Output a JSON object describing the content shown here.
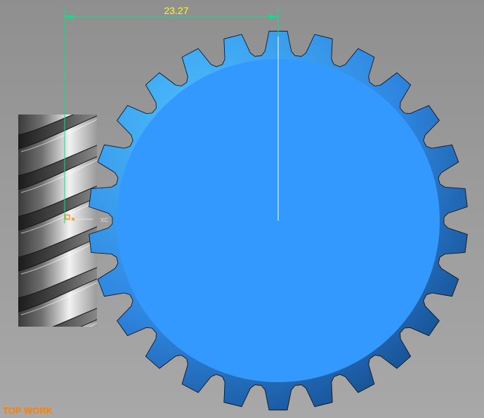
{
  "viewport": {
    "view_name": "TOP WORK",
    "view_name_color": "#ff7f00"
  },
  "dimension": {
    "value": "23.27",
    "text_color": "#ffff00",
    "line_color": "#00e58a"
  },
  "csys": {
    "xc_label": "XC",
    "origin_color": "#ff7f00",
    "axis_color": "#e6e6e6"
  },
  "model": {
    "gear": {
      "tooth_count": 26,
      "face_color": "#3399ff",
      "edge_color": "#0a0a0a"
    },
    "worm": {
      "thread_turns": 5,
      "metal_color": "#b9b9b9"
    }
  }
}
